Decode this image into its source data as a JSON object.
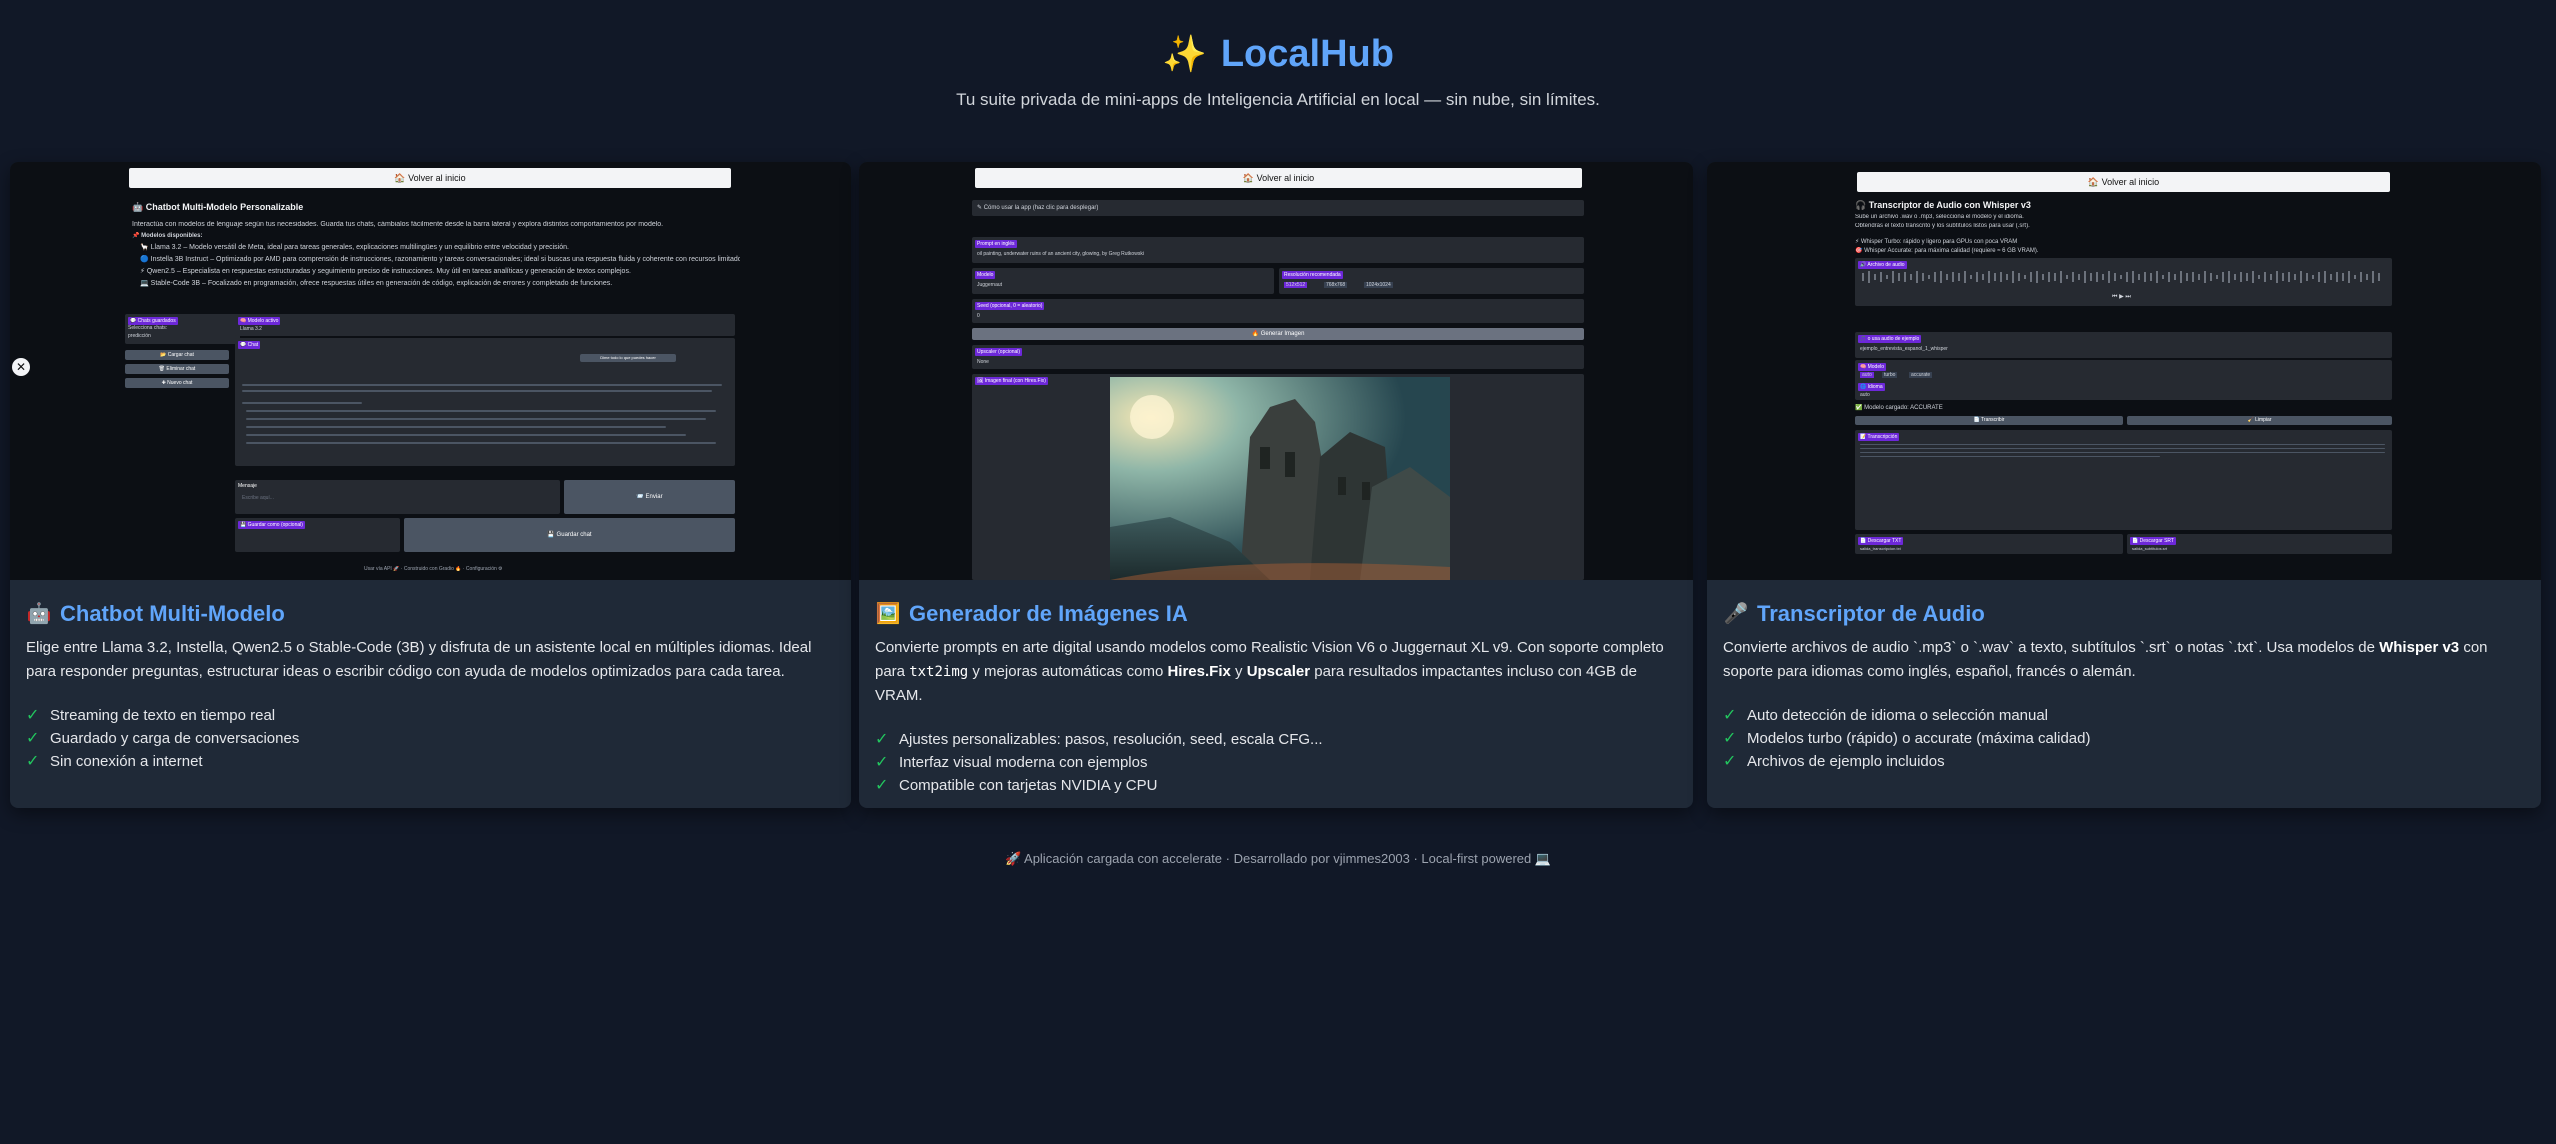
{
  "app": {
    "title": "LocalHub",
    "subtitle": "Tu suite privada de mini-apps de Inteligencia Artificial en local — sin nube, sin límites.",
    "footer": "🚀 Aplicación cargada con accelerate · Desarrollado por vjimmes2003 · Local-first powered 💻"
  },
  "cards": [
    {
      "emoji": "🤖",
      "title": "Chatbot Multi-Modelo",
      "desc_1": "Elige entre Llama 3.2, Instella, Qwen2.5 o Stable-Code (3B) y disfruta de un asistente local en múltiples idiomas. Ideal para responder preguntas, estructurar ideas o escribir código con ayuda de modelos optimizados para cada tarea.",
      "features": [
        "Streaming de texto en tiempo real",
        "Guardado y carga de conversaciones",
        "Sin conexión a internet"
      ],
      "preview": {
        "back": "🏠 Volver al inicio",
        "heading": "🤖 Chatbot Multi-Modelo Personalizable",
        "intro": "Interactúa con modelos de lenguaje según tus necesidades. Guarda tus chats, cámbialos fácilmente desde la barra lateral y explora distintos comportamientos por modelo.",
        "models_label": "📌 Modelos disponibles:",
        "models": [
          "🦙 Llama 3.2 – Modelo versátil de Meta, ideal para tareas generales, explicaciones multilingües y un equilibrio entre velocidad y precisión.",
          "🔵 Instella 3B Instruct – Optimizado por AMD para comprensión de instrucciones, razonamiento y tareas conversacionales; ideal si buscas una respuesta fluida y coherente con recursos limitados.",
          "⚡ Qwen2.5 – Especialista en respuestas estructuradas y seguimiento preciso de instrucciones. Muy útil en tareas analíticas y generación de textos complejos.",
          "💻 Stable-Code 3B – Focalizado en programación, ofrece respuestas útiles en generación de código, explicación de errores y completado de funciones."
        ],
        "sidebar_label": "💬 Chats guardados",
        "sidebar_sub": "Selecciona chats:",
        "sidebar_value": "predicción",
        "btn_load": "📂 Cargar chat",
        "btn_delete": "🗑 Eliminar chat",
        "btn_new": "✚ Nuevo chat",
        "model_label": "🧠 Modelo activo",
        "model_value": "Llama 3.2",
        "chat_label": "💬 Chat",
        "bubble": "Dime todo lo que puedes hacer",
        "msg_label": "Mensaje",
        "msg_placeholder": "Escribe aquí...",
        "send": "📨 Enviar",
        "save_label": "💾 Guardar como (opcional)",
        "save_btn": "💾 Guardar chat",
        "footer": "Usar vía API 🚀 · Construido con Gradio 🔥 · Configuración ⚙"
      }
    },
    {
      "emoji": "🖼️",
      "title": "Generador de Imágenes IA",
      "desc_1": "Convierte prompts en arte digital usando modelos como Realistic Vision V6 o Juggernaut XL v9. Con soporte completo para",
      "desc_code": "txt2img",
      "desc_2": "y mejoras automáticas como",
      "desc_b1": "Hires.Fix",
      "desc_3": "y",
      "desc_b2": "Upscaler",
      "desc_4": "para resultados impactantes incluso con 4GB de VRAM.",
      "features": [
        "Ajustes personalizables: pasos, resolución, seed, escala CFG...",
        "Interfaz visual moderna con ejemplos",
        "Compatible con tarjetas NVIDIA y CPU"
      ],
      "preview": {
        "back": "🏠 Volver al inicio",
        "examples": "✎ Cómo usar la app (haz clic para desplegar)",
        "prompt_label": "Prompt en inglés",
        "prompt_value": "oil painting, underwater ruins of an ancient city, glowing, by Greg Rutkowski",
        "model_label": "Modelo",
        "model_value": "Juggernaut",
        "res_label": "Resolución recomendada",
        "res_opts": [
          "512x512",
          "768x768",
          "1024x1024"
        ],
        "seed_label": "Seed (opcional, 0 = aleatorio)",
        "seed_value": "0",
        "generate": "🔥 Generar Imagen",
        "scaler_label": "Upscaler (opcional)",
        "scaler_value": "None",
        "image_label": "🖼 Imagen final (con Hires.Fix)"
      }
    },
    {
      "emoji": "🎤",
      "title": "Transcriptor de Audio",
      "desc_1": "Convierte archivos de audio `.mp3` o `.wav` a texto, subtítulos `.srt` o notas `.txt`. Usa modelos de",
      "desc_b1": "Whisper v3",
      "desc_2": "con soporte para idiomas como inglés, español, francés o alemán.",
      "features": [
        "Auto detección de idioma o selección manual",
        "Modelos turbo (rápido) o accurate (máxima calidad)",
        "Archivos de ejemplo incluidos"
      ],
      "preview": {
        "back": "🏠 Volver al inicio",
        "heading": "🎧 Transcriptor de Audio con Whisper v3",
        "intro_1": "Sube un archivo .wav o .mp3, selecciona el modelo y el idioma.",
        "intro_2": "Obtendrás el texto transcrito y los subtítulos listos para usar (.srt).",
        "model_a": "⚡ Whisper Turbo: rápido y ligero para GPUs con poca VRAM",
        "model_b": "🎯 Whisper Accurate: para máxima calidad (requiere ≈ 6 GB VRAM).",
        "audio_label": "🔊 Archivo de audio",
        "example_label": "🎵 o usa audio de ejemplo",
        "example_value": "ejemplo_entrevista_espanol_1_whisper",
        "model_label": "🧠 Modelo",
        "model_opts": [
          "auto",
          "turbo",
          "accurate"
        ],
        "lang_label": "🌐 Idioma",
        "lang_value": "auto",
        "loaded": "✅ Modelo cargado: ACCURATE",
        "btn_transcribe": "📄 Transcribir",
        "btn_clear": "🧹 Limpiar",
        "transcript_label": "📝 Transcripción",
        "txt_label": "📄 Descargar TXT",
        "txt_value": "salida_transcripcion.txt",
        "srt_label": "📄 Descargar SRT",
        "srt_value": "salida_subtitulos.srt"
      }
    }
  ],
  "colors": {
    "background": "#111827",
    "card": "#1f2937",
    "accent": "#60a5fa",
    "check": "#22c55e"
  },
  "icons": [
    "sparkles-icon",
    "robot-icon",
    "picture-icon",
    "microphone-icon",
    "check-icon",
    "close-icon",
    "rocket-icon",
    "laptop-icon"
  ]
}
